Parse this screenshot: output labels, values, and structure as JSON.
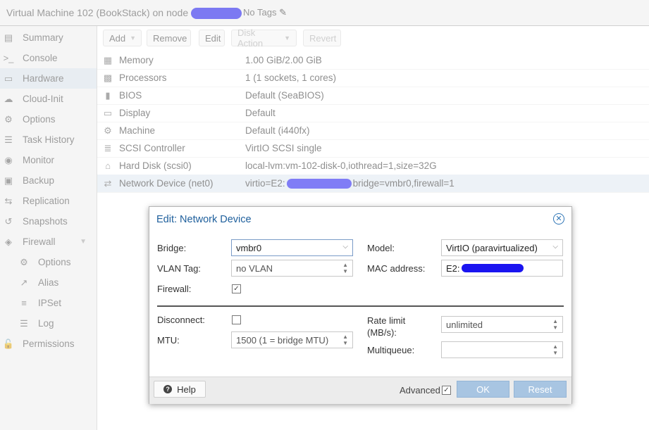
{
  "titlebar": {
    "vm_title": "Virtual Machine 102 (BookStack) on node",
    "tags": "No Tags"
  },
  "sidebar": {
    "items": [
      {
        "label": "Summary",
        "icon": "summary-icon",
        "glyph": "▤"
      },
      {
        "label": "Console",
        "icon": "console-icon",
        "glyph": ">_"
      },
      {
        "label": "Hardware",
        "icon": "monitor-icon",
        "glyph": "▭"
      },
      {
        "label": "Cloud-Init",
        "icon": "cloud-icon",
        "glyph": "☁"
      },
      {
        "label": "Options",
        "icon": "gear-icon",
        "glyph": "⚙"
      },
      {
        "label": "Task History",
        "icon": "list-icon",
        "glyph": "☰"
      },
      {
        "label": "Monitor",
        "icon": "eye-icon",
        "glyph": "◉"
      },
      {
        "label": "Backup",
        "icon": "floppy-icon",
        "glyph": "▣"
      },
      {
        "label": "Replication",
        "icon": "retweet-icon",
        "glyph": "⇆"
      },
      {
        "label": "Snapshots",
        "icon": "history-icon",
        "glyph": "↺"
      },
      {
        "label": "Firewall",
        "icon": "shield-icon",
        "glyph": "◈"
      },
      {
        "label": "Options",
        "icon": "gear-icon",
        "glyph": "⚙"
      },
      {
        "label": "Alias",
        "icon": "external-link-icon",
        "glyph": "↗"
      },
      {
        "label": "IPSet",
        "icon": "list-ol-icon",
        "glyph": "≡"
      },
      {
        "label": "Log",
        "icon": "list-icon",
        "glyph": "☰"
      },
      {
        "label": "Permissions",
        "icon": "unlock-icon",
        "glyph": "🔓"
      }
    ]
  },
  "toolbar": {
    "add": "Add",
    "remove": "Remove",
    "edit": "Edit",
    "disk_action": "Disk Action",
    "revert": "Revert"
  },
  "hardware": [
    {
      "name": "Memory",
      "value": "1.00 GiB/2.00 GiB",
      "icon": "memory-icon",
      "glyph": "▦"
    },
    {
      "name": "Processors",
      "value": "1 (1 sockets, 1 cores)",
      "icon": "cpu-icon",
      "glyph": "▩"
    },
    {
      "name": "BIOS",
      "value": "Default (SeaBIOS)",
      "icon": "microchip-icon",
      "glyph": "▮"
    },
    {
      "name": "Display",
      "value": "Default",
      "icon": "desktop-icon",
      "glyph": "▭"
    },
    {
      "name": "Machine",
      "value": "Default (i440fx)",
      "icon": "cogs-icon",
      "glyph": "⚙"
    },
    {
      "name": "SCSI Controller",
      "value": "VirtIO SCSI single",
      "icon": "database-icon",
      "glyph": "≣"
    },
    {
      "name": "Hard Disk (scsi0)",
      "value": "local-lvm:vm-102-disk-0,iothread=1,size=32G",
      "icon": "hdd-icon",
      "glyph": "⌂"
    },
    {
      "name": "Network Device (net0)",
      "value_prefix": "virtio=E2:",
      "value_suffix": "bridge=vmbr0,firewall=1",
      "icon": "exchange-icon",
      "glyph": "⇄"
    }
  ],
  "dialog": {
    "title": "Edit: Network Device",
    "bridge_label": "Bridge:",
    "bridge_value": "vmbr0",
    "vlan_label": "VLAN Tag:",
    "vlan_value": "no VLAN",
    "firewall_label": "Firewall:",
    "firewall_checked": "✓",
    "model_label": "Model:",
    "model_value": "VirtIO (paravirtualized)",
    "mac_label": "MAC address:",
    "mac_value": "E2:",
    "disconnect_label": "Disconnect:",
    "mtu_label": "MTU:",
    "mtu_value": "1500 (1 = bridge MTU)",
    "rate_label": "Rate limit (MB/s):",
    "rate_value": "unlimited",
    "multiqueue_label": "Multiqueue:",
    "multiqueue_value": "",
    "help": "Help",
    "advanced": "Advanced",
    "advanced_checked": "✓",
    "ok": "OK",
    "reset": "Reset"
  },
  "colors": {
    "accent": "#1e5f9c",
    "selected": "#dfe8f1",
    "button_disabled": "#a8c5e2",
    "redaction": "#1a14f0"
  }
}
